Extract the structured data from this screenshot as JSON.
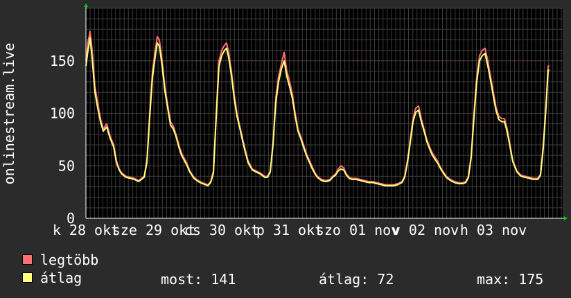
{
  "chart_data": {
    "type": "line",
    "ylabel": "onlinestream.live",
    "ylim": [
      0,
      200
    ],
    "yticks": [
      0,
      50,
      100,
      150
    ],
    "xlim": [
      0,
      688
    ],
    "xtick_labels": [
      {
        "x": 0,
        "label": "k 28 okt"
      },
      {
        "x": 98,
        "label": "sze 29 okt"
      },
      {
        "x": 196,
        "label": "cs 30 okt"
      },
      {
        "x": 294,
        "label": "p 31 okt"
      },
      {
        "x": 392,
        "label": "szo 01 nov"
      },
      {
        "x": 490,
        "label": "v 02 nov"
      },
      {
        "x": 588,
        "label": "h 03 nov"
      }
    ],
    "grid": true,
    "series": [
      {
        "name": "legtöbb",
        "color": "#ff7070",
        "points": [
          [
            0,
            150
          ],
          [
            3,
            168
          ],
          [
            6,
            178
          ],
          [
            9,
            160
          ],
          [
            13,
            125
          ],
          [
            17,
            110
          ],
          [
            21,
            95
          ],
          [
            25,
            85
          ],
          [
            30,
            90
          ],
          [
            35,
            78
          ],
          [
            40,
            70
          ],
          [
            44,
            55
          ],
          [
            48,
            47
          ],
          [
            52,
            43
          ],
          [
            58,
            40
          ],
          [
            64,
            39
          ],
          [
            70,
            38
          ],
          [
            76,
            36
          ],
          [
            80,
            38
          ],
          [
            84,
            40
          ],
          [
            88,
            55
          ],
          [
            92,
            100
          ],
          [
            96,
            140
          ],
          [
            100,
            160
          ],
          [
            103,
            173
          ],
          [
            106,
            170
          ],
          [
            110,
            150
          ],
          [
            114,
            125
          ],
          [
            118,
            108
          ],
          [
            122,
            92
          ],
          [
            126,
            88
          ],
          [
            130,
            80
          ],
          [
            134,
            70
          ],
          [
            138,
            62
          ],
          [
            142,
            57
          ],
          [
            146,
            52
          ],
          [
            150,
            45
          ],
          [
            156,
            39
          ],
          [
            162,
            36
          ],
          [
            168,
            34
          ],
          [
            172,
            33
          ],
          [
            176,
            32
          ],
          [
            180,
            35
          ],
          [
            184,
            45
          ],
          [
            188,
            100
          ],
          [
            192,
            150
          ],
          [
            196,
            160
          ],
          [
            200,
            165
          ],
          [
            203,
            167
          ],
          [
            206,
            158
          ],
          [
            210,
            140
          ],
          [
            214,
            118
          ],
          [
            218,
            100
          ],
          [
            222,
            88
          ],
          [
            226,
            76
          ],
          [
            230,
            65
          ],
          [
            234,
            55
          ],
          [
            240,
            47
          ],
          [
            246,
            45
          ],
          [
            252,
            43
          ],
          [
            258,
            40
          ],
          [
            262,
            40
          ],
          [
            266,
            45
          ],
          [
            270,
            72
          ],
          [
            274,
            115
          ],
          [
            278,
            135
          ],
          [
            282,
            147
          ],
          [
            286,
            158
          ],
          [
            290,
            140
          ],
          [
            294,
            130
          ],
          [
            298,
            118
          ],
          [
            302,
            100
          ],
          [
            306,
            85
          ],
          [
            310,
            78
          ],
          [
            314,
            70
          ],
          [
            318,
            62
          ],
          [
            322,
            56
          ],
          [
            326,
            50
          ],
          [
            330,
            44
          ],
          [
            334,
            40
          ],
          [
            340,
            37
          ],
          [
            346,
            36
          ],
          [
            352,
            37
          ],
          [
            356,
            40
          ],
          [
            360,
            42
          ],
          [
            364,
            47
          ],
          [
            368,
            50
          ],
          [
            372,
            48
          ],
          [
            376,
            42
          ],
          [
            380,
            39
          ],
          [
            384,
            38
          ],
          [
            390,
            38
          ],
          [
            396,
            37
          ],
          [
            402,
            36
          ],
          [
            408,
            35
          ],
          [
            414,
            35
          ],
          [
            420,
            34
          ],
          [
            426,
            33
          ],
          [
            432,
            32
          ],
          [
            438,
            32
          ],
          [
            444,
            32
          ],
          [
            450,
            33
          ],
          [
            456,
            35
          ],
          [
            460,
            40
          ],
          [
            464,
            55
          ],
          [
            468,
            75
          ],
          [
            472,
            95
          ],
          [
            476,
            105
          ],
          [
            480,
            107
          ],
          [
            484,
            95
          ],
          [
            488,
            85
          ],
          [
            492,
            75
          ],
          [
            496,
            68
          ],
          [
            500,
            62
          ],
          [
            504,
            58
          ],
          [
            508,
            54
          ],
          [
            512,
            48
          ],
          [
            516,
            44
          ],
          [
            520,
            40
          ],
          [
            526,
            37
          ],
          [
            532,
            35
          ],
          [
            538,
            34
          ],
          [
            544,
            34
          ],
          [
            548,
            35
          ],
          [
            552,
            40
          ],
          [
            556,
            60
          ],
          [
            560,
            100
          ],
          [
            564,
            135
          ],
          [
            568,
            155
          ],
          [
            572,
            160
          ],
          [
            576,
            162
          ],
          [
            580,
            150
          ],
          [
            584,
            135
          ],
          [
            588,
            120
          ],
          [
            592,
            105
          ],
          [
            596,
            97
          ],
          [
            600,
            95
          ],
          [
            604,
            95
          ],
          [
            608,
            85
          ],
          [
            612,
            70
          ],
          [
            616,
            55
          ],
          [
            622,
            45
          ],
          [
            628,
            41
          ],
          [
            634,
            40
          ],
          [
            640,
            39
          ],
          [
            646,
            38
          ],
          [
            652,
            38
          ],
          [
            656,
            42
          ],
          [
            660,
            70
          ],
          [
            664,
            110
          ],
          [
            667,
            145
          ],
          [
            669,
            145
          ]
        ]
      },
      {
        "name": "átlag",
        "color": "#ffff80",
        "points": [
          [
            0,
            145
          ],
          [
            3,
            160
          ],
          [
            6,
            172
          ],
          [
            9,
            152
          ],
          [
            13,
            120
          ],
          [
            17,
            105
          ],
          [
            21,
            92
          ],
          [
            25,
            83
          ],
          [
            30,
            87
          ],
          [
            35,
            76
          ],
          [
            40,
            68
          ],
          [
            44,
            53
          ],
          [
            48,
            46
          ],
          [
            52,
            42
          ],
          [
            58,
            39
          ],
          [
            64,
            38
          ],
          [
            70,
            37
          ],
          [
            76,
            35
          ],
          [
            80,
            37
          ],
          [
            84,
            39
          ],
          [
            88,
            53
          ],
          [
            92,
            96
          ],
          [
            96,
            134
          ],
          [
            100,
            154
          ],
          [
            103,
            167
          ],
          [
            106,
            164
          ],
          [
            110,
            145
          ],
          [
            114,
            121
          ],
          [
            118,
            105
          ],
          [
            122,
            89
          ],
          [
            126,
            85
          ],
          [
            130,
            78
          ],
          [
            134,
            68
          ],
          [
            138,
            60
          ],
          [
            142,
            55
          ],
          [
            146,
            50
          ],
          [
            150,
            44
          ],
          [
            156,
            38
          ],
          [
            162,
            35
          ],
          [
            168,
            33
          ],
          [
            172,
            32
          ],
          [
            176,
            31
          ],
          [
            180,
            34
          ],
          [
            184,
            43
          ],
          [
            188,
            96
          ],
          [
            192,
            145
          ],
          [
            196,
            155
          ],
          [
            200,
            160
          ],
          [
            203,
            162
          ],
          [
            206,
            153
          ],
          [
            210,
            136
          ],
          [
            214,
            114
          ],
          [
            218,
            97
          ],
          [
            222,
            86
          ],
          [
            226,
            74
          ],
          [
            230,
            63
          ],
          [
            234,
            53
          ],
          [
            240,
            46
          ],
          [
            246,
            44
          ],
          [
            252,
            42
          ],
          [
            258,
            39
          ],
          [
            262,
            39
          ],
          [
            266,
            44
          ],
          [
            270,
            70
          ],
          [
            274,
            110
          ],
          [
            278,
            130
          ],
          [
            282,
            142
          ],
          [
            286,
            150
          ],
          [
            290,
            135
          ],
          [
            294,
            125
          ],
          [
            298,
            114
          ],
          [
            302,
            97
          ],
          [
            306,
            83
          ],
          [
            310,
            76
          ],
          [
            314,
            68
          ],
          [
            318,
            60
          ],
          [
            322,
            54
          ],
          [
            326,
            48
          ],
          [
            330,
            43
          ],
          [
            334,
            39
          ],
          [
            340,
            36
          ],
          [
            346,
            35
          ],
          [
            352,
            36
          ],
          [
            356,
            39
          ],
          [
            360,
            41
          ],
          [
            364,
            45
          ],
          [
            368,
            47
          ],
          [
            372,
            46
          ],
          [
            376,
            41
          ],
          [
            380,
            38
          ],
          [
            384,
            37
          ],
          [
            390,
            37
          ],
          [
            396,
            36
          ],
          [
            402,
            35
          ],
          [
            408,
            34
          ],
          [
            414,
            34
          ],
          [
            420,
            33
          ],
          [
            426,
            32
          ],
          [
            432,
            31
          ],
          [
            438,
            31
          ],
          [
            444,
            31
          ],
          [
            450,
            32
          ],
          [
            456,
            34
          ],
          [
            460,
            39
          ],
          [
            464,
            53
          ],
          [
            468,
            72
          ],
          [
            472,
            92
          ],
          [
            476,
            101
          ],
          [
            480,
            103
          ],
          [
            484,
            92
          ],
          [
            488,
            83
          ],
          [
            492,
            73
          ],
          [
            496,
            66
          ],
          [
            500,
            60
          ],
          [
            504,
            56
          ],
          [
            508,
            52
          ],
          [
            512,
            47
          ],
          [
            516,
            43
          ],
          [
            520,
            39
          ],
          [
            526,
            36
          ],
          [
            532,
            34
          ],
          [
            538,
            33
          ],
          [
            544,
            33
          ],
          [
            548,
            34
          ],
          [
            552,
            39
          ],
          [
            556,
            58
          ],
          [
            560,
            96
          ],
          [
            564,
            130
          ],
          [
            568,
            150
          ],
          [
            572,
            155
          ],
          [
            576,
            157
          ],
          [
            580,
            145
          ],
          [
            584,
            131
          ],
          [
            588,
            116
          ],
          [
            592,
            102
          ],
          [
            596,
            94
          ],
          [
            600,
            92
          ],
          [
            604,
            92
          ],
          [
            608,
            82
          ],
          [
            612,
            68
          ],
          [
            616,
            54
          ],
          [
            622,
            44
          ],
          [
            628,
            40
          ],
          [
            634,
            39
          ],
          [
            640,
            38
          ],
          [
            646,
            37
          ],
          [
            652,
            37
          ],
          [
            656,
            41
          ],
          [
            660,
            67
          ],
          [
            664,
            106
          ],
          [
            667,
            141
          ],
          [
            669,
            141
          ]
        ]
      }
    ]
  },
  "legend": {
    "items": [
      {
        "label": "legtöbb",
        "color": "#ff7070"
      },
      {
        "label": "átlag",
        "color": "#ffff80"
      }
    ]
  },
  "stats": {
    "current": "most: 141",
    "average": "átlag: 72",
    "max": "max: 175"
  }
}
